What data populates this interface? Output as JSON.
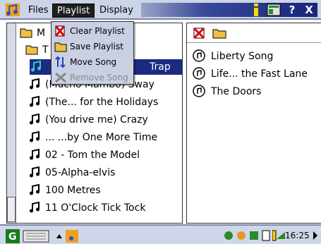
{
  "menubar": {
    "items": [
      {
        "label": "Files"
      },
      {
        "label": "Playlist"
      },
      {
        "label": "Display"
      }
    ],
    "title_buttons": [
      "?",
      "X"
    ]
  },
  "playlist_menu": {
    "items": [
      {
        "label": "Clear Playlist",
        "enabled": true
      },
      {
        "label": "Save Playlist",
        "enabled": true
      },
      {
        "label": "Move Song",
        "enabled": true
      },
      {
        "label": "Remove Song",
        "enabled": false
      }
    ]
  },
  "left_tree": {
    "folders": [
      {
        "label": "M"
      },
      {
        "label": "T"
      }
    ],
    "selected_row": {
      "label": "Trap"
    },
    "songs": [
      {
        "label": "(Mucho Mambo) Sway"
      },
      {
        "label": "(The... for the Holidays"
      },
      {
        "label": "(You drive me) Crazy"
      },
      {
        "label": "... ...by One More Time"
      },
      {
        "label": "02 - Tom the Model"
      },
      {
        "label": "05-Alpha-elvis"
      },
      {
        "label": "100 Metres"
      },
      {
        "label": "11 O'Clock Tick Tock"
      }
    ]
  },
  "playlist_panel": {
    "items": [
      {
        "label": "Liberty Song"
      },
      {
        "label": "Life... the Fast Lane"
      },
      {
        "label": "The Doors"
      }
    ]
  },
  "taskbar": {
    "clock": "16:25",
    "colors": {
      "accent": "#17257a",
      "panel": "#ccd4e7"
    }
  }
}
